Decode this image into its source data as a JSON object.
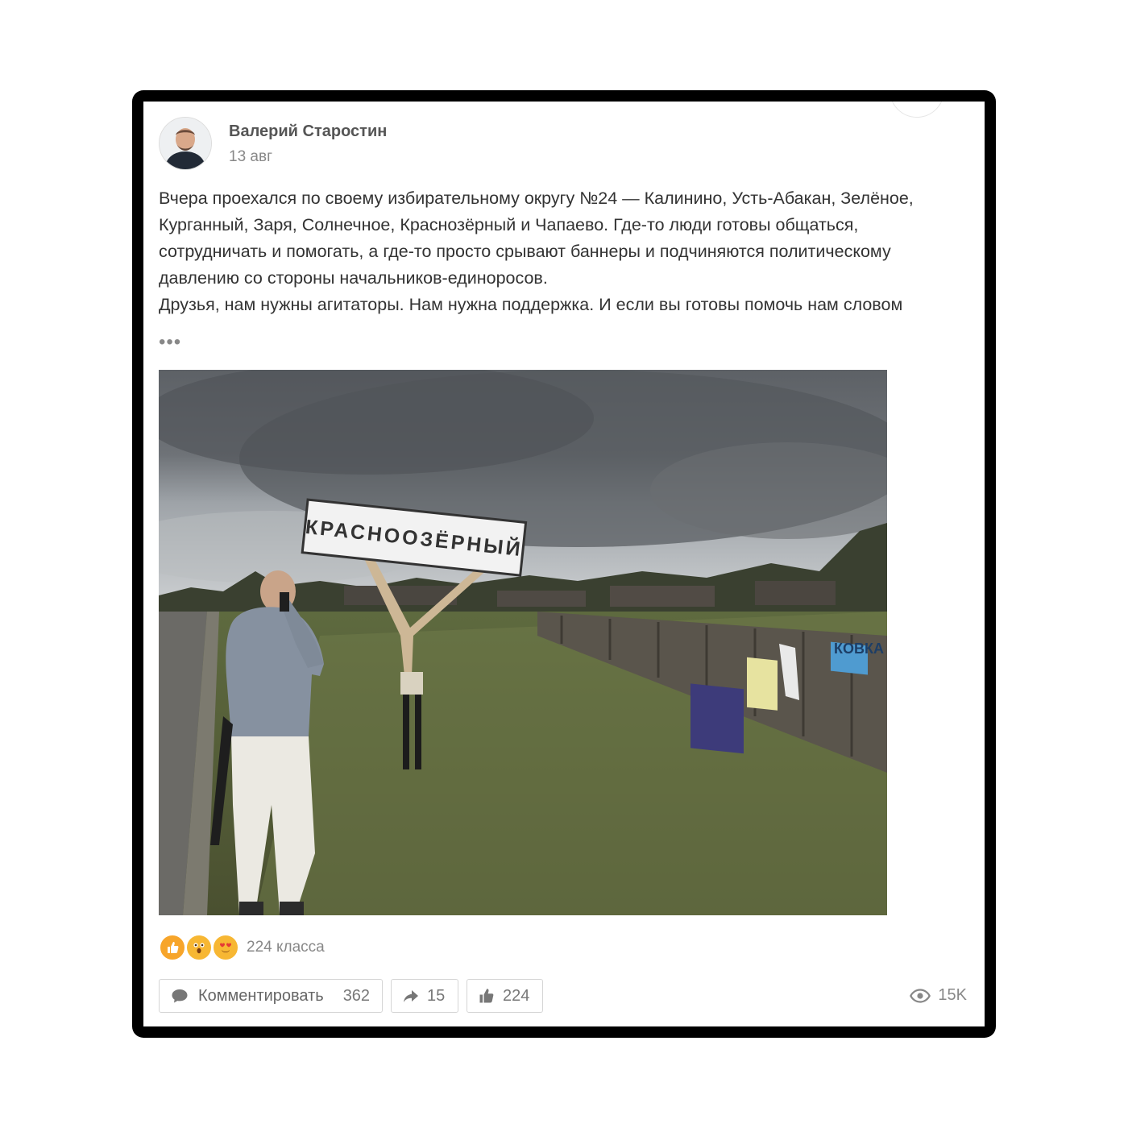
{
  "post": {
    "author": "Валерий Старостин",
    "date": "13 авг",
    "text_p1": "Вчера проехался по своему избирательному округу №24 — Калинино, Усть-Абакан, Зелёное, Курганный, Заря, Солнечное, Краснозёрный и Чапаево. Где-то люди готовы общаться, сотрудничать и помогать, а где-то просто срывают баннеры и подчиняются политическому давлению со стороны начальников-единоросов.",
    "text_p2": "Друзья, нам нужны агитаторы. Нам нужна поддержка. И если вы готовы помочь нам словом",
    "more_label": "•••",
    "photo": {
      "sign_text": "КРАСНООЗЁРНЫЙ",
      "fence_sign_text": "КОВКА"
    }
  },
  "reactions": {
    "icons": [
      "thumbs-up-icon",
      "surprised-face-icon",
      "heart-eyes-icon"
    ],
    "count_label": "224 класса"
  },
  "actions": {
    "comment_label": "Комментировать",
    "comment_count": "362",
    "share_count": "15",
    "like_count": "224"
  },
  "views": {
    "count": "15K"
  },
  "colors": {
    "frame": "#000000",
    "text": "#333333",
    "muted": "#888888",
    "reaction_orange": "#f7a52a"
  }
}
